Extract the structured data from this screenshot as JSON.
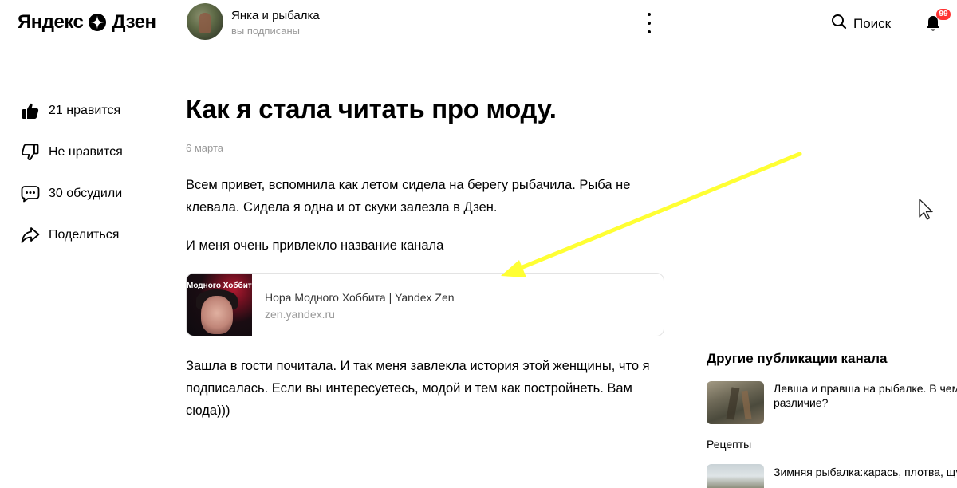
{
  "header": {
    "logo_left": "Яндекс",
    "logo_right": "Дзен",
    "channel_name": "Янка и рыбалка",
    "channel_status": "вы подписаны",
    "search_label": "Поиск",
    "notifications_count": "99"
  },
  "actions": [
    {
      "label": "21 нравится",
      "icon": "thumbs-up-icon"
    },
    {
      "label": "Не нравится",
      "icon": "thumbs-down-icon"
    },
    {
      "label": "30 обсудили",
      "icon": "comment-icon"
    },
    {
      "label": "Поделиться",
      "icon": "share-icon"
    }
  ],
  "article": {
    "title": "Как я стала читать про моду.",
    "date": "6 марта",
    "paragraph1": "Всем привет, вспомнила как летом сидела на берегу рыбачила. Рыба не клевала. Сидела я одна и от скуки залезла в Дзен.",
    "paragraph2": "И меня очень привлекло название канала",
    "paragraph3": "Зашла в гости почитала. И так меня завлекла история этой женщины, что я подписалась. Если вы интересуетесь, модой и тем как постройнеть. Вам сюда)))"
  },
  "link_card": {
    "image_caption": "Модного Хоббит",
    "title": "Нора Модного Хоббита | Yandex Zen",
    "url": "zen.yandex.ru"
  },
  "sidebar": {
    "heading": "Другие публикации канала",
    "items": [
      {
        "title_line1": "Левша и правша на рыбалке. В чем",
        "title_line2": "различие?"
      },
      {
        "title": "Зимняя рыбалка:карась, плотва, щука"
      }
    ],
    "category": "Рецепты"
  },
  "colors": {
    "accent_badge": "#ff3333",
    "annotation_arrow": "#ffff33",
    "muted_text": "#999999"
  }
}
